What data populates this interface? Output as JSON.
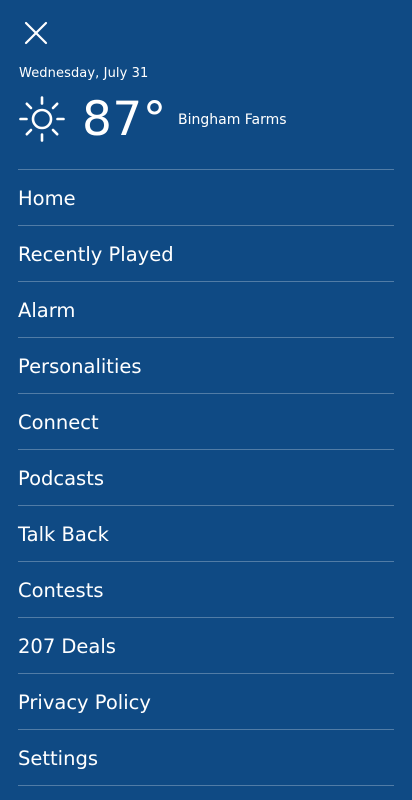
{
  "header": {
    "close_icon": "close-icon"
  },
  "weather": {
    "date": "Wednesday, July 31",
    "icon": "sun-icon",
    "temperature": "87°",
    "location": "Bingham Farms"
  },
  "menu": {
    "items": [
      {
        "label": "Home"
      },
      {
        "label": "Recently Played"
      },
      {
        "label": "Alarm"
      },
      {
        "label": "Personalities"
      },
      {
        "label": "Connect"
      },
      {
        "label": "Podcasts"
      },
      {
        "label": "Talk Back"
      },
      {
        "label": "Contests"
      },
      {
        "label": "207 Deals"
      },
      {
        "label": "Privacy Policy"
      },
      {
        "label": "Settings"
      }
    ]
  },
  "colors": {
    "background": "#0f4a84",
    "text": "#ffffff",
    "divider": "rgba(255,255,255,0.28)"
  }
}
